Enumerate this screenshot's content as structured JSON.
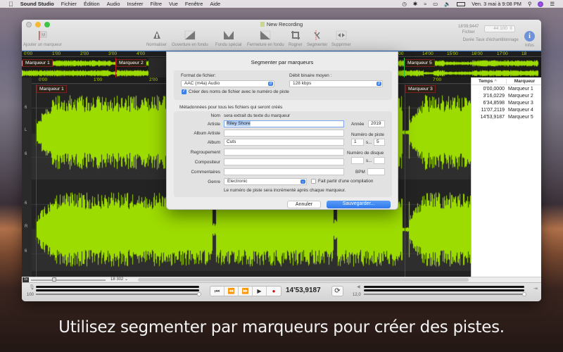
{
  "menubar": {
    "app_name": "Sound Studio",
    "items": [
      "Fichier",
      "Édition",
      "Audio",
      "Insérer",
      "Filtre",
      "Vue",
      "Fenêtre",
      "Aide"
    ],
    "clock": "Ven. 3 mai à 9:08 PM"
  },
  "window": {
    "title": "New Recording",
    "toolbar": {
      "add_marker": "Ajouter un marqueur",
      "normalize": "Normaliser",
      "fade_in": "Ouverture en fondu",
      "special_fade": "Fondu spécial",
      "fade_out": "Fermeture en fondu",
      "crop": "Rogner",
      "split": "Segmenter",
      "delete": "Supprimer",
      "duration_value": "18'09,9447",
      "duration_sub": "Fichier",
      "duration_label": "Durée",
      "sample_rate_value": "44 100",
      "sample_rate_label": "Taux d'échantillonnage",
      "info": "Infos"
    }
  },
  "overview": {
    "ruler_left": [
      "0'00",
      "1'00",
      "2'00",
      "3'00",
      "4'00"
    ],
    "ruler_right": [
      "'00",
      "14'00",
      "15'00",
      "16'00",
      "17'00",
      "18"
    ],
    "markers": [
      "Marqueur 1",
      "Marqueur 2",
      "Marqueur 5"
    ]
  },
  "editor": {
    "ruler": [
      "0'00",
      "1'00",
      "2'00",
      "7'00"
    ],
    "markers": [
      "Marqueur 1",
      "Marqueur 3"
    ],
    "scale_left": [
      "6",
      "L",
      "6"
    ],
    "scale_right": [
      "6",
      "R",
      "6"
    ],
    "zoom_label": "1x",
    "zoom_value": "18 302"
  },
  "marker_table": {
    "headers": {
      "time": "Temps",
      "marker": "Marqueur"
    },
    "rows": [
      {
        "time": "0'00,0000",
        "name": "Marqueur 1"
      },
      {
        "time": "3'16,0229",
        "name": "Marqueur 2"
      },
      {
        "time": "6'34,8598",
        "name": "Marqueur 3"
      },
      {
        "time": "11'07,2119",
        "name": "Marqueur 4"
      },
      {
        "time": "14'53,9187",
        "name": "Marqueur 5"
      }
    ]
  },
  "transport": {
    "input_level": "100",
    "position": "14'53,9187",
    "output_level": "12,0"
  },
  "dialog": {
    "title": "Segmenter par marqueurs",
    "format_label": "Format de fichier:",
    "format_value": "AAC (m4a) Audio",
    "bitrate_label": "Débit binaire moyen :",
    "bitrate_value": "128 kbps",
    "track_names_checkbox": "Créer des noms de fichier avec le numéro de piste",
    "track_names_checked": true,
    "metadata_heading": "Métadonnées pour tous les fichiers qui seront créés",
    "name_label": "Nom",
    "name_value": "sera extrait du texte du marqueur",
    "artist_label": "Artiste",
    "artist_value": "Riley Shore",
    "album_artist_label": "Album Artiste",
    "album_artist_value": "",
    "album_label": "Album",
    "album_value": "Cuts",
    "grouping_label": "Regroupement",
    "grouping_value": "",
    "composer_label": "Compositeur",
    "composer_value": "",
    "comments_label": "Commentaires",
    "comments_value": "",
    "genre_label": "Genre",
    "genre_value": "Electronic",
    "compilation_label": "Fait partir d'une compilation",
    "compilation_checked": false,
    "year_label": "Année",
    "year_value": "2019",
    "track_number_label": "Numéro de piste",
    "track_number_value": "1",
    "track_total_value": "5",
    "of_label": "s...",
    "disc_number_label": "Numéro de disque",
    "disc_number_value": "",
    "disc_total_value": "",
    "bpm_label": "BPM",
    "bpm_value": "",
    "note": "Le numéro de piste sera incrémenté après chaque marqueur.",
    "cancel": "Annuler",
    "save": "Sauvegarder..."
  },
  "caption": "Utilisez segmenter par marqueurs pour créer des pistes.",
  "colors": {
    "wave": "#9ddc00",
    "accent": "#3a80e8",
    "marker": "#b02020"
  }
}
